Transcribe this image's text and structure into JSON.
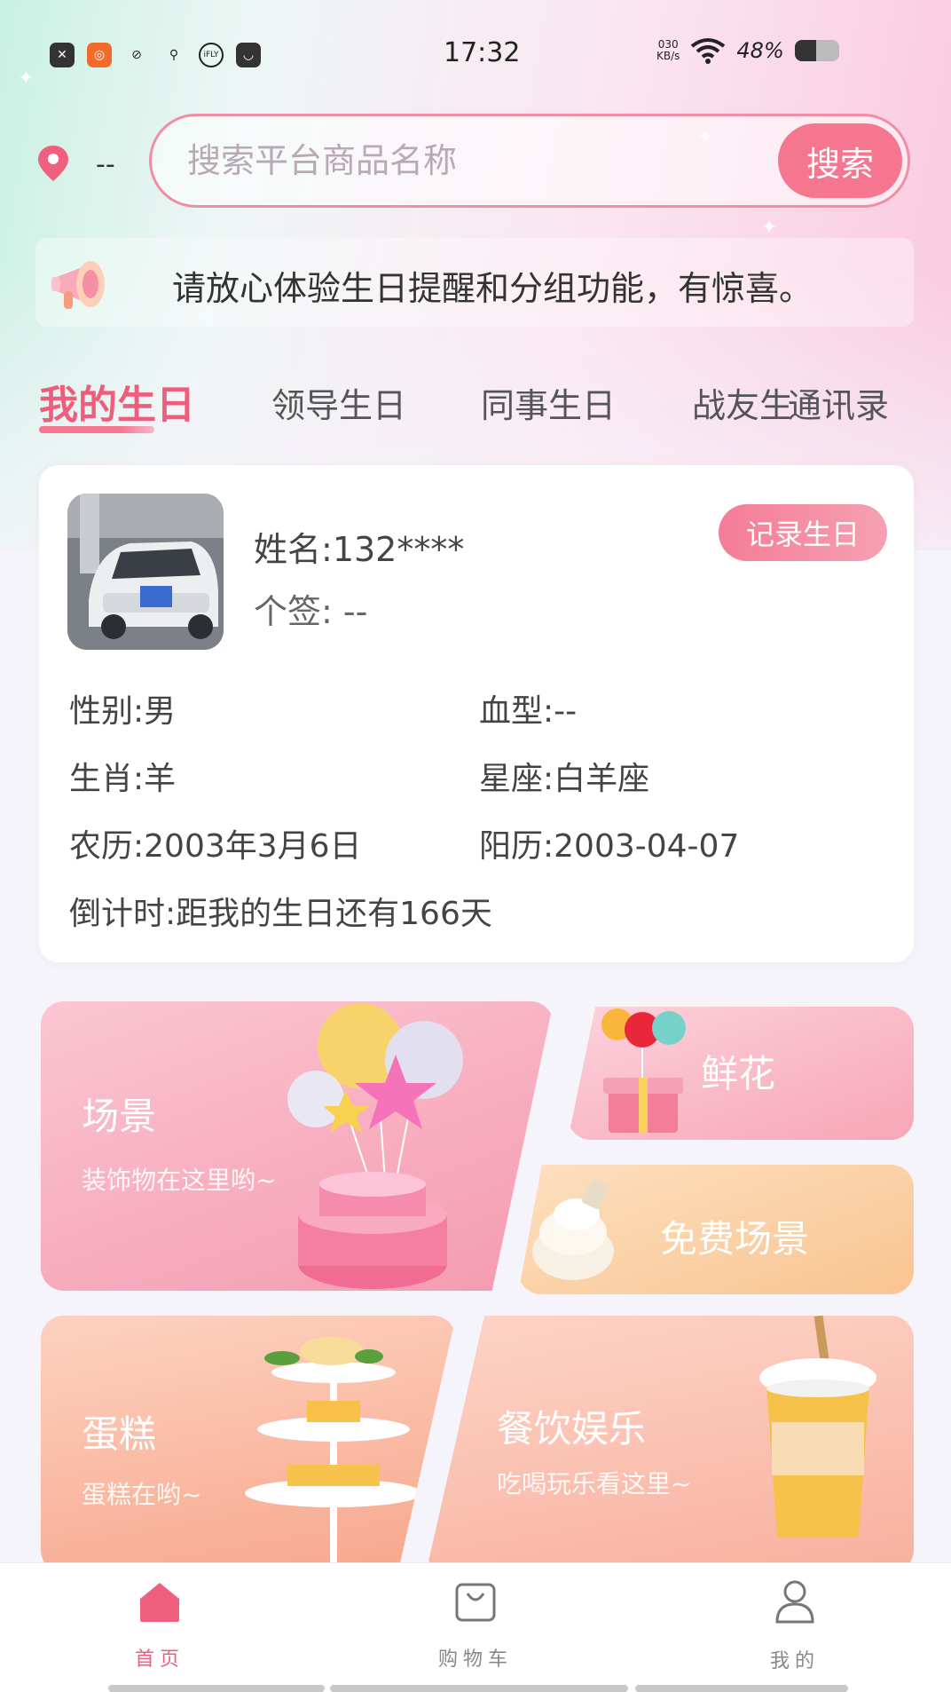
{
  "status_bar": {
    "time": "17:32",
    "net_speed_value": "030",
    "net_speed_unit": "KB/s",
    "battery_percent": "48%",
    "battery_level": 0.48,
    "app_icons": [
      "close-app-icon",
      "taobao-icon",
      "link-icon",
      "du-map-icon",
      "ifly-icon",
      "bag-icon"
    ]
  },
  "location": {
    "text": "--"
  },
  "search": {
    "placeholder": "搜索平台商品名称",
    "button_label": "搜索"
  },
  "notice": {
    "text": "请放心体验生日提醒和分组功能，有惊喜。"
  },
  "tabs": [
    {
      "label": "我的生日",
      "active": true
    },
    {
      "label": "领导生日",
      "active": false
    },
    {
      "label": "同事生日",
      "active": false
    },
    {
      "label": "战友生日",
      "active": false
    },
    {
      "label": "通讯录",
      "active": false
    }
  ],
  "profile": {
    "name_label": "姓名:",
    "name_value": "132****",
    "sig_label": "个签:",
    "sig_value": "--",
    "record_button": "记录生日",
    "gender": "性别:男",
    "blood_type": "血型:--",
    "zodiac": "生肖:羊",
    "constellation": "星座:白羊座",
    "lunar": "农历:2003年3月6日",
    "solar": "阳历:2003-04-07",
    "countdown": "倒计时:距我的生日还有166天"
  },
  "tiles": {
    "scene": {
      "title": "场景",
      "subtitle": "装饰物在这里哟~"
    },
    "flower": {
      "title": "鲜花"
    },
    "free_scene": {
      "title": "免费场景"
    },
    "cake": {
      "title": "蛋糕",
      "subtitle": "蛋糕在哟~"
    },
    "food": {
      "title": "餐饮娱乐",
      "subtitle": "吃喝玩乐看这里~"
    }
  },
  "nav": {
    "home": "首页",
    "cart": "购物车",
    "mine": "我的"
  },
  "colors": {
    "accent": "#ef5d7c",
    "search_button": "#f4768f"
  }
}
